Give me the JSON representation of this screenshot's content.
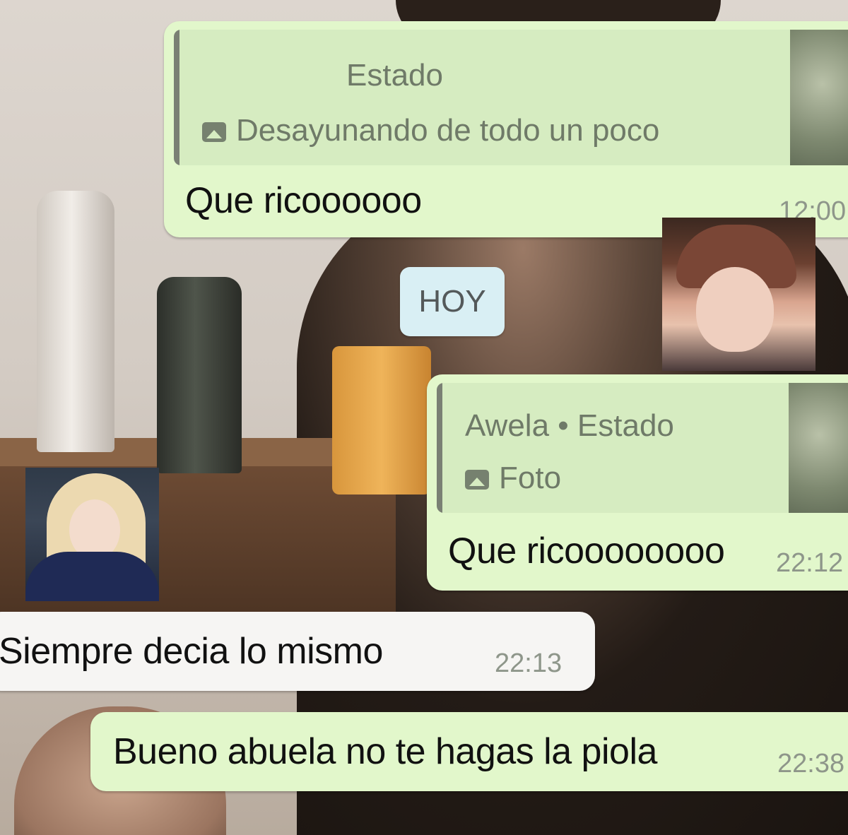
{
  "chat": {
    "msg1": {
      "quote_title": "Estado",
      "quote_subtitle": "Desayunando de todo un poco",
      "text": "Que ricoooooo",
      "time": "12:00"
    },
    "day_separator": "HOY",
    "msg2": {
      "quote_title": "Awela • Estado",
      "quote_subtitle": "Foto",
      "text": "Que ricoooooooo",
      "time": "22:12"
    },
    "msg3": {
      "text": "Siempre decia lo mismo",
      "time": "22:13"
    },
    "msg4": {
      "text": "Bueno abuela no te hagas la piola",
      "time": "22:38"
    }
  },
  "icons": {
    "quote_media": "image-icon"
  },
  "colors": {
    "outgoing_bubble": "#e2f7cb",
    "incoming_bubble": "#f6f5f3",
    "day_chip": "#d9eff4"
  }
}
